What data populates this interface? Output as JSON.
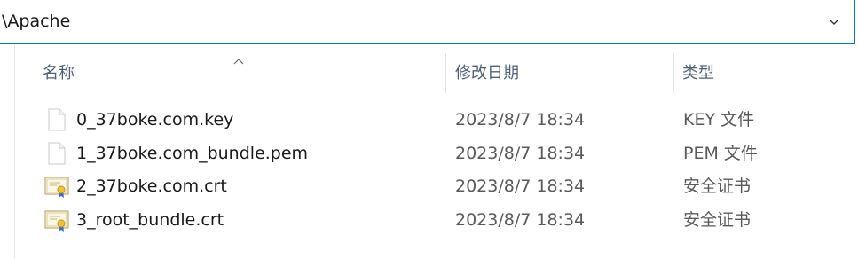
{
  "address_bar": {
    "path": "\\Apache",
    "dropdown_icon": "chevron-down-icon"
  },
  "columns": {
    "name": "名称",
    "modified": "修改日期",
    "type": "类型",
    "sort_icon": "sort-ascending-icon"
  },
  "files": [
    {
      "name": "0_37boke.com.key",
      "modified": "2023/8/7 18:34",
      "type": "KEY 文件",
      "icon": "blank-file-icon"
    },
    {
      "name": "1_37boke.com_bundle.pem",
      "modified": "2023/8/7 18:34",
      "type": "PEM 文件",
      "icon": "blank-file-icon"
    },
    {
      "name": "2_37boke.com.crt",
      "modified": "2023/8/7 18:34",
      "type": "安全证书",
      "icon": "certificate-icon"
    },
    {
      "name": "3_root_bundle.crt",
      "modified": "2023/8/7 18:34",
      "type": "安全证书",
      "icon": "certificate-icon"
    }
  ]
}
